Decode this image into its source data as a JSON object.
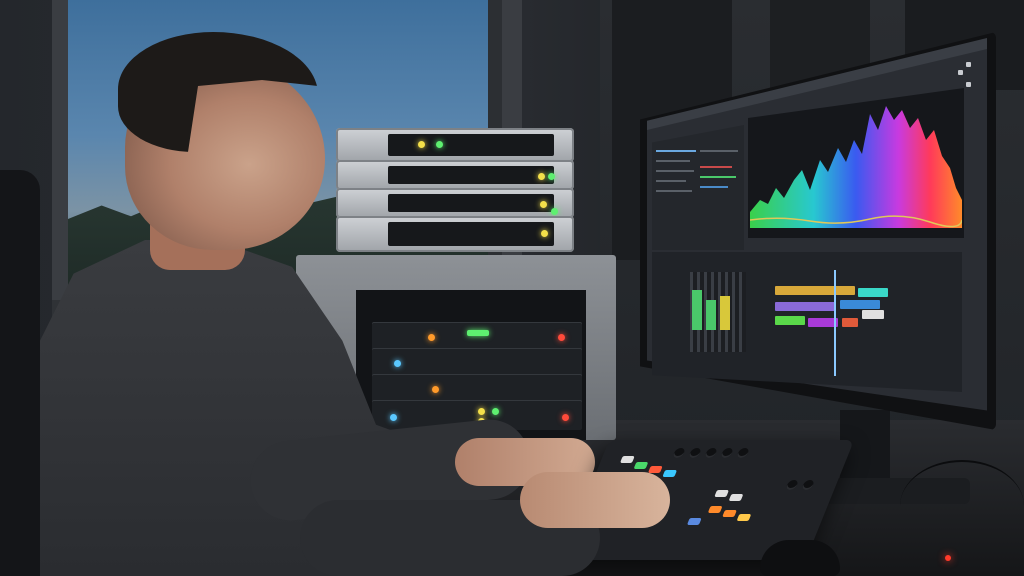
{
  "scene": {
    "description_colors": {
      "sky": "#5a86ae",
      "screen_bg": "#2a2d33",
      "led_yellow": "#f4e04a",
      "led_green": "#5ef070",
      "led_red": "#ff4a3a",
      "led_blue": "#5ac8ff"
    }
  },
  "icons": {
    "monitor": "monitor-icon",
    "controller": "midi-controller-icon",
    "rack": "server-rack-icon"
  }
}
